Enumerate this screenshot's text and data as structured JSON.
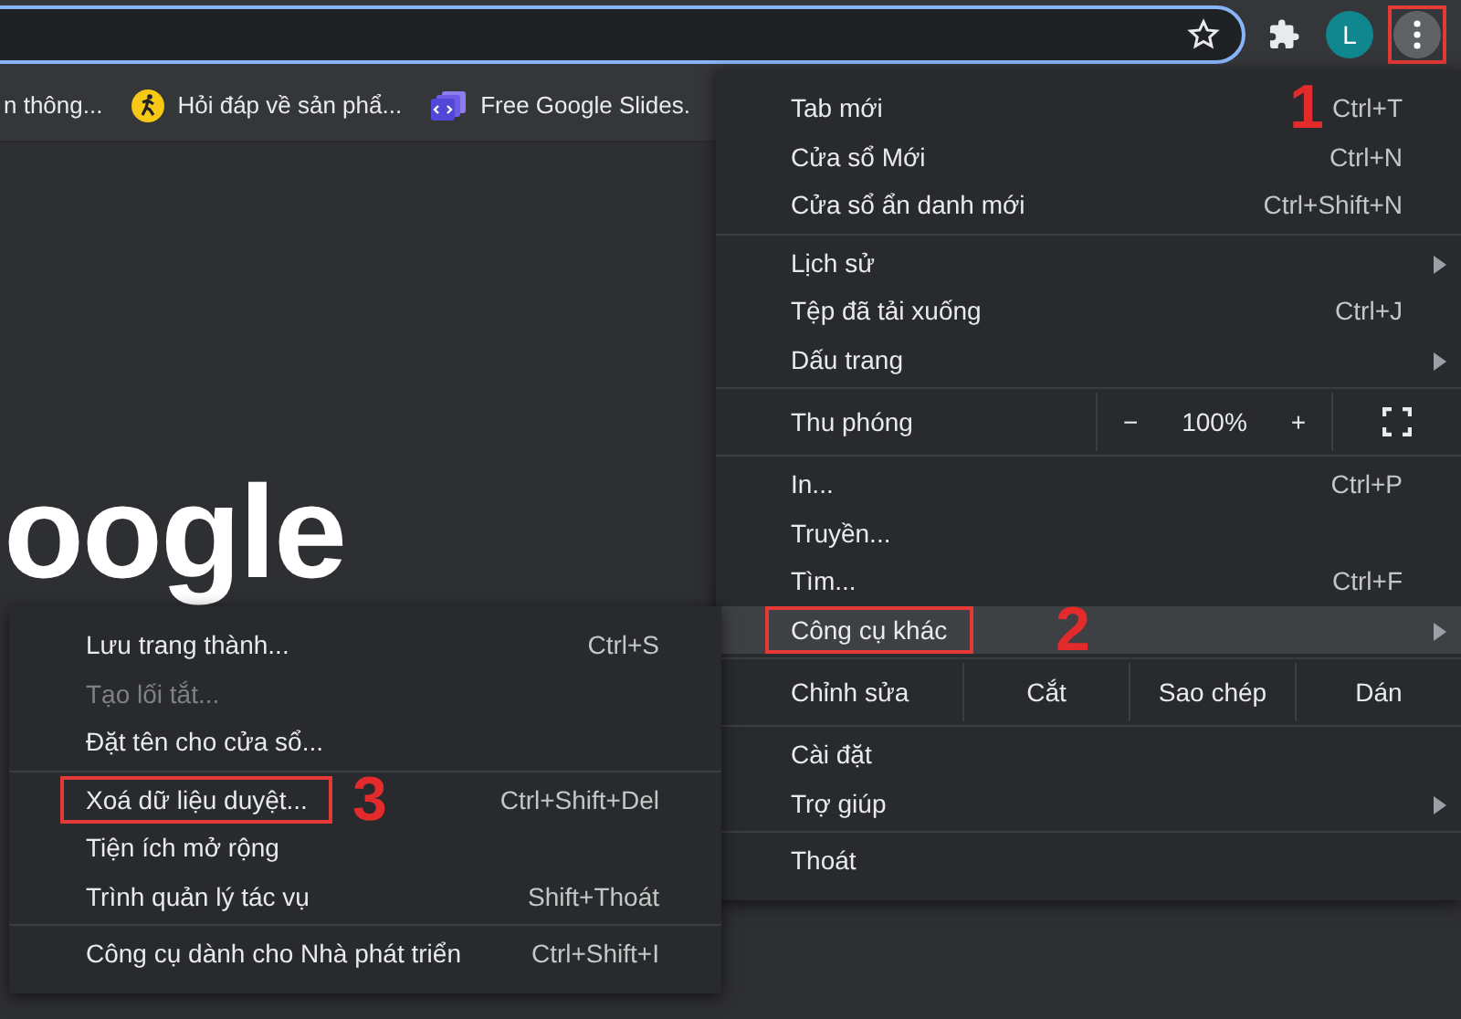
{
  "toolbar": {
    "avatar_letter": "L",
    "menu_button": {
      "annotation": "1"
    }
  },
  "bookmarks": [
    {
      "label": "n thông...",
      "kind": "plain"
    },
    {
      "label": "Hỏi đáp về sản phẩ...",
      "kind": "support"
    },
    {
      "label": "Free Google Slides.",
      "kind": "slides"
    }
  ],
  "page": {
    "logo_text": "oogle"
  },
  "main_menu": [
    [
      {
        "kind": "item",
        "label": "Tab mới",
        "shortcut": "Ctrl+T",
        "has_submenu": false,
        "hovered": false,
        "disabled": false
      },
      {
        "kind": "item",
        "label": "Cửa sổ Mới",
        "shortcut": "Ctrl+N",
        "has_submenu": false,
        "hovered": false,
        "disabled": false
      },
      {
        "kind": "item",
        "label": "Cửa sổ ẩn danh mới",
        "shortcut": "Ctrl+Shift+N",
        "has_submenu": false,
        "hovered": false,
        "disabled": false
      }
    ],
    [
      {
        "kind": "item",
        "label": "Lịch sử",
        "has_submenu": true,
        "hovered": false,
        "disabled": false
      },
      {
        "kind": "item",
        "label": "Tệp đã tải xuống",
        "shortcut": "Ctrl+J",
        "has_submenu": false,
        "hovered": false,
        "disabled": false
      },
      {
        "kind": "item",
        "label": "Dấu trang",
        "has_submenu": true,
        "hovered": false,
        "disabled": false
      }
    ],
    [
      {
        "kind": "zoom",
        "label": "Thu phóng",
        "minus": "−",
        "value": "100%",
        "plus": "+"
      }
    ],
    [
      {
        "kind": "item",
        "label": "In...",
        "shortcut": "Ctrl+P",
        "has_submenu": false,
        "hovered": false,
        "disabled": false
      },
      {
        "kind": "item",
        "label": "Truyền...",
        "has_submenu": false,
        "hovered": false,
        "disabled": false
      },
      {
        "kind": "item",
        "label": "Tìm...",
        "shortcut": "Ctrl+F",
        "has_submenu": false,
        "hovered": false,
        "disabled": false
      },
      {
        "kind": "item",
        "label": "Công cụ khác",
        "has_submenu": true,
        "hovered": true,
        "disabled": false,
        "annotation": "2"
      }
    ],
    [
      {
        "kind": "edit",
        "label": "Chỉnh sửa",
        "actions": [
          "Cắt",
          "Sao chép",
          "Dán"
        ]
      }
    ],
    [
      {
        "kind": "item",
        "label": "Cài đặt",
        "has_submenu": false,
        "hovered": false,
        "disabled": false
      },
      {
        "kind": "item",
        "label": "Trợ giúp",
        "has_submenu": true,
        "hovered": false,
        "disabled": false
      }
    ],
    [
      {
        "kind": "item",
        "label": "Thoát",
        "has_submenu": false,
        "hovered": false,
        "disabled": false
      }
    ]
  ],
  "sub_menu": [
    [
      {
        "kind": "item",
        "label": "Lưu trang thành...",
        "shortcut": "Ctrl+S",
        "has_submenu": false,
        "hovered": false,
        "disabled": false
      },
      {
        "kind": "item",
        "label": "Tạo lối tắt...",
        "has_submenu": false,
        "hovered": false,
        "disabled": true
      },
      {
        "kind": "item",
        "label": "Đặt tên cho cửa sổ...",
        "has_submenu": false,
        "hovered": false,
        "disabled": false
      }
    ],
    [
      {
        "kind": "item",
        "label": "Xoá dữ liệu duyệt...",
        "shortcut": "Ctrl+Shift+Del",
        "has_submenu": false,
        "hovered": false,
        "disabled": false,
        "annotation": "3"
      },
      {
        "kind": "item",
        "label": "Tiện ích mở rộng",
        "has_submenu": false,
        "hovered": false,
        "disabled": false
      },
      {
        "kind": "item",
        "label": "Trình quản lý tác vụ",
        "shortcut": "Shift+Thoát",
        "has_submenu": false,
        "hovered": false,
        "disabled": false
      }
    ],
    [
      {
        "kind": "item",
        "label": "Công cụ dành cho Nhà phát triển",
        "shortcut": "Ctrl+Shift+I",
        "has_submenu": false,
        "hovered": false,
        "disabled": false
      }
    ]
  ]
}
